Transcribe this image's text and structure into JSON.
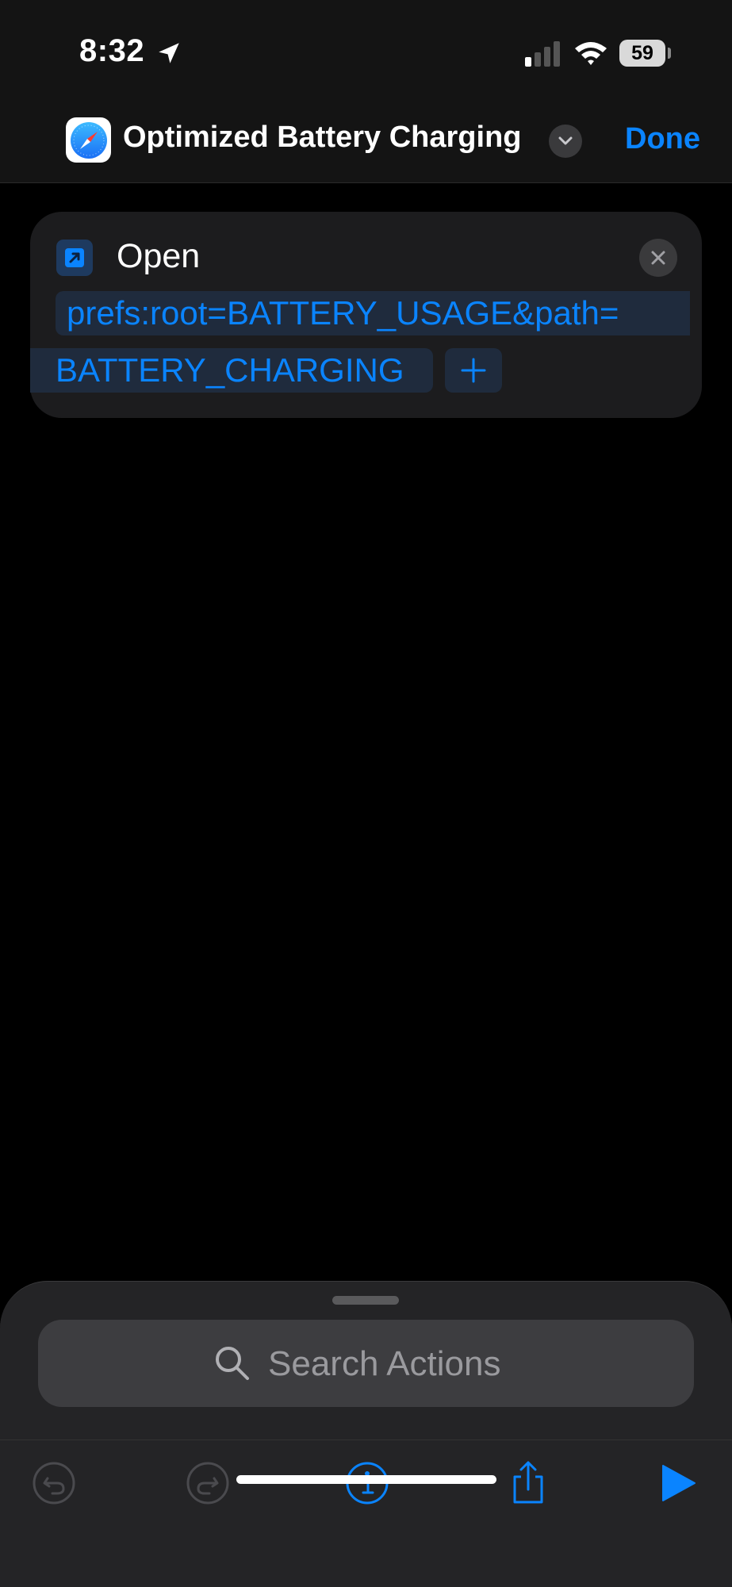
{
  "status_bar": {
    "time": "8:32",
    "battery_level": "59",
    "icons": [
      "location-arrow-icon",
      "cellular-signal-icon",
      "wifi-icon",
      "battery-icon"
    ]
  },
  "nav": {
    "app_icon": "safari-compass-icon",
    "title": "Optimized Battery Charging",
    "chevron_icon": "chevron-down-icon",
    "done_label": "Done"
  },
  "action": {
    "icon": "open-url-arrow-icon",
    "label": "Open",
    "url_line1": "prefs:root=BATTERY_USAGE&path=",
    "url_line2": "BATTERY_CHARGING",
    "add_icon": "plus-icon",
    "close_icon": "close-x-icon"
  },
  "search": {
    "placeholder": "Search Actions",
    "icon": "search-icon"
  },
  "toolbar": {
    "undo_icon": "undo-icon",
    "redo_icon": "redo-icon",
    "info_icon": "info-icon",
    "share_icon": "share-icon",
    "run_icon": "play-icon"
  },
  "colors": {
    "accent": "#0a84ff",
    "background": "#000000",
    "card": "#1c1c1e",
    "sheet": "#242426"
  }
}
